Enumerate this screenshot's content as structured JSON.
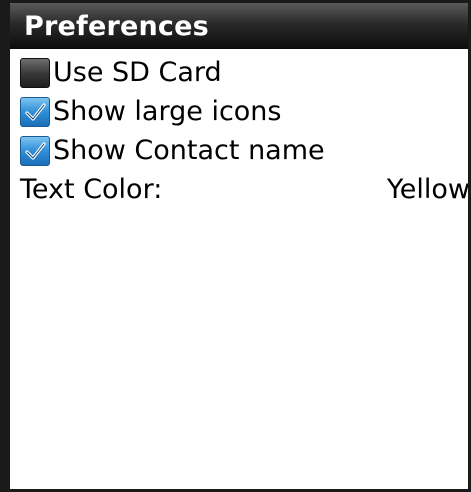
{
  "header": {
    "title": "Preferences"
  },
  "options": [
    {
      "label": "Use SD Card",
      "checked": false
    },
    {
      "label": "Show large icons",
      "checked": true
    },
    {
      "label": "Show Contact name",
      "checked": true
    }
  ],
  "text_color": {
    "label": "Text Color:",
    "value": "Yellow"
  },
  "colors": {
    "titlebar": "#0c0c0c",
    "checkbox_checked": "#2f8fd8",
    "checkbox_unchecked": "#3a3a3a",
    "background": "#ffffff"
  }
}
